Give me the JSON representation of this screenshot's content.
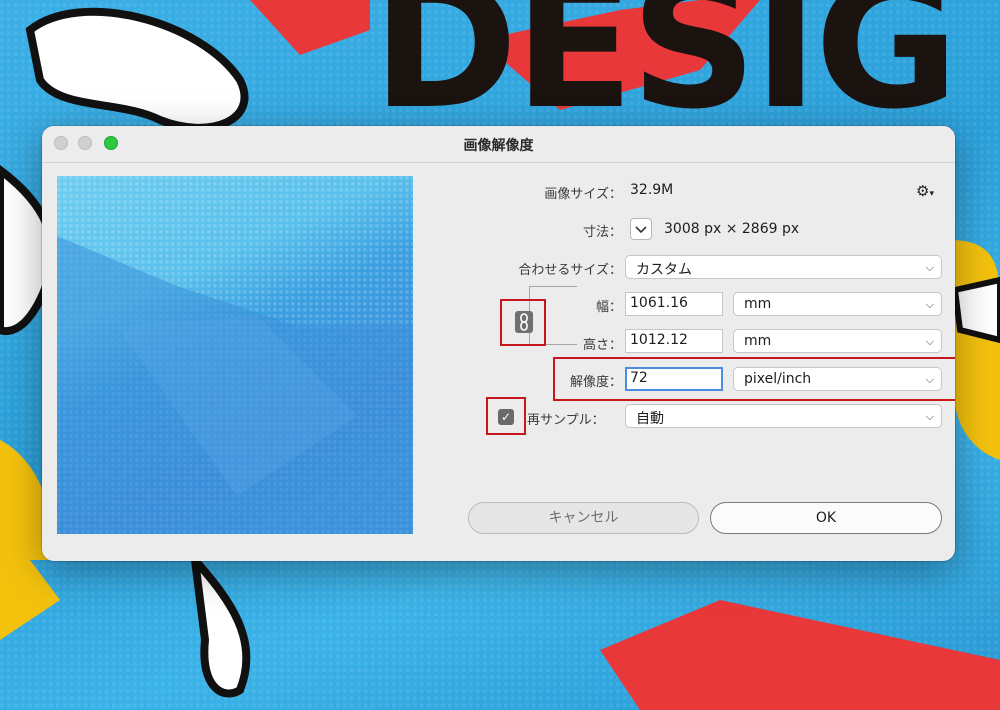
{
  "background": {
    "text": "DESIG"
  },
  "dialog": {
    "title": "画像解像度",
    "image_size_label": "画像サイズ：",
    "image_size_value": "32.9M",
    "dimensions_label": "寸法：",
    "dimensions_value": "3008 px × 2869 px",
    "fit_to_label": "合わせるサイズ：",
    "fit_to_value": "カスタム",
    "width_label": "幅：",
    "width_value": "1061.16",
    "width_unit": "mm",
    "height_label": "高さ：",
    "height_value": "1012.12",
    "height_unit": "mm",
    "resolution_label": "解像度：",
    "resolution_value": "72",
    "resolution_unit": "pixel/inch",
    "resample_label": "再サンプル：",
    "resample_value": "自動",
    "resample_checked": true,
    "cancel_label": "キャンセル",
    "ok_label": "OK"
  },
  "icons": {
    "settings": "gear-icon",
    "dropdown": "chevron-down-icon",
    "constrain": "link-icon",
    "check": "checkmark-icon"
  },
  "colors": {
    "highlight": "#c8161d",
    "zoom_button": "#2bc840",
    "focus": "#4a8de0"
  }
}
